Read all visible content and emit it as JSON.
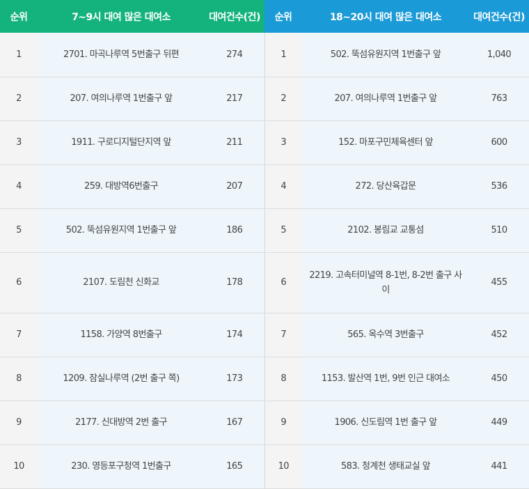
{
  "headers": {
    "rank_left": "순위",
    "station_left": "7~9시 대여 많은 대여소",
    "count_left": "대여건수(건)",
    "rank_right": "순위",
    "station_right": "18~20시 대여 많은 대여소",
    "count_right": "대여건수(건)"
  },
  "colors": {
    "morning_header": "#14b37d",
    "evening_header": "#1a9ad6"
  },
  "rows": [
    {
      "rank_left": "1",
      "station_left": "2701. 마곡나루역 5번출구 뒤편",
      "count_left": "274",
      "rank_right": "1",
      "station_right": "502. 뚝섬유원지역 1번출구 앞",
      "count_right": "1,040"
    },
    {
      "rank_left": "2",
      "station_left": "207. 여의나루역 1번출구 앞",
      "count_left": "217",
      "rank_right": "2",
      "station_right": "207. 여의나루역 1번출구 앞",
      "count_right": "763"
    },
    {
      "rank_left": "3",
      "station_left": "1911. 구로디지털단지역 앞",
      "count_left": "211",
      "rank_right": "3",
      "station_right": "152. 마포구민체육센터 앞",
      "count_right": "600"
    },
    {
      "rank_left": "4",
      "station_left": "259. 대방역6번출구",
      "count_left": "207",
      "rank_right": "4",
      "station_right": "272. 당산육갑문",
      "count_right": "536"
    },
    {
      "rank_left": "5",
      "station_left": "502. 뚝섬유원지역 1번출구 앞",
      "count_left": "186",
      "rank_right": "5",
      "station_right": "2102. 봉림교 교통섬",
      "count_right": "510"
    },
    {
      "rank_left": "6",
      "station_left": "2107. 도림천 신화교",
      "count_left": "178",
      "rank_right": "6",
      "station_right": "2219. 고속터미널역 8-1번, 8-2번 출구 사이",
      "count_right": "455"
    },
    {
      "rank_left": "7",
      "station_left": "1158. 가양역 8번출구",
      "count_left": "174",
      "rank_right": "7",
      "station_right": "565. 옥수역 3번출구",
      "count_right": "452"
    },
    {
      "rank_left": "8",
      "station_left": "1209. 잠실나루역 (2번 출구 쪽)",
      "count_left": "173",
      "rank_right": "8",
      "station_right": "1153. 발산역 1번, 9번 인근 대여소",
      "count_right": "450"
    },
    {
      "rank_left": "9",
      "station_left": "2177. 신대방역 2번 출구",
      "count_left": "167",
      "rank_right": "9",
      "station_right": "1906. 신도림역 1번 출구 앞",
      "count_right": "449"
    },
    {
      "rank_left": "10",
      "station_left": "230. 영등포구청역 1번출구",
      "count_left": "165",
      "rank_right": "10",
      "station_right": "583. 청계천 생태교실 앞",
      "count_right": "441"
    }
  ]
}
